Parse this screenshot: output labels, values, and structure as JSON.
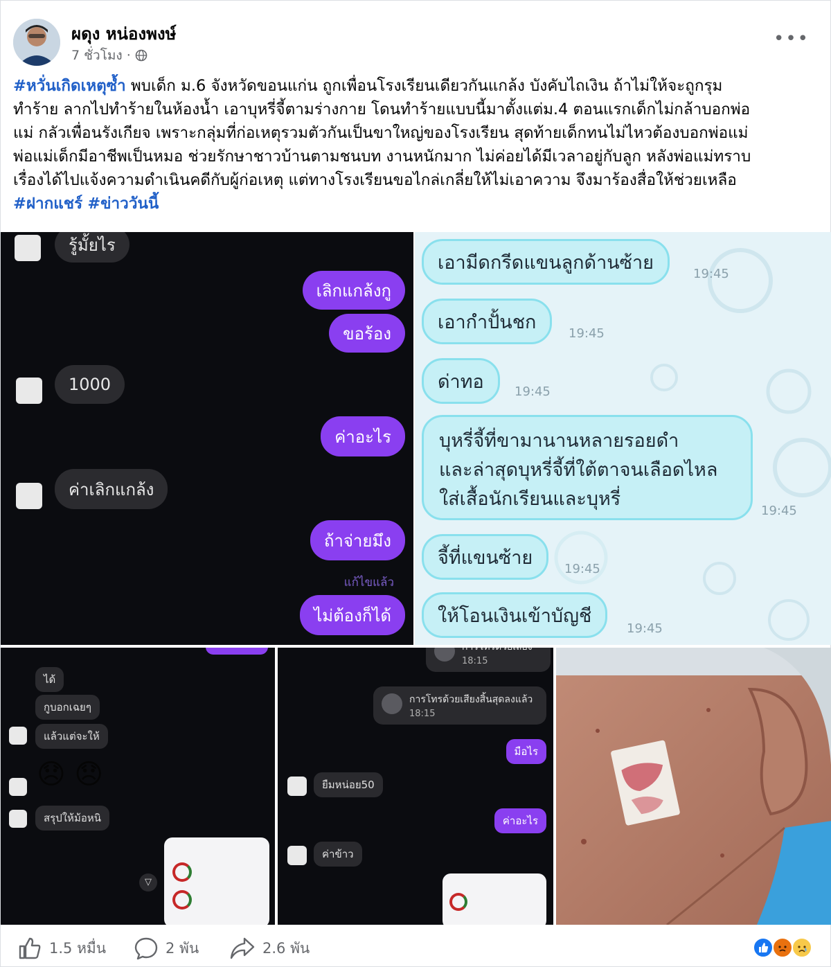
{
  "post": {
    "author": "ผดุง หน่องพงษ์",
    "time": "7 ชั่วโมง",
    "separator": "·",
    "more": "•••",
    "text_lines": [
      {
        "hashtag": "#หวั่นเกิดเหตุซ้ำ",
        "text": " พบเด็ก ม.6 จังหวัดขอนแก่น ถูกเพื่อนโรงเรียนเดียวกันแกล้ง บังคับไถเงิน ถ้าไม่ให้จะถูกรุม"
      },
      {
        "text": "ทำร้าย ลากไปทำร้ายในห้องน้ำ เอาบุหรี่จี้ตามร่างกาย โดนทำร้ายแบบนี้มาตั้งแต่ม.4 ตอนแรกเด็กไม่กล้าบอกพ่อ"
      },
      {
        "text": "แม่ กลัวเพื่อนรังเกียจ เพราะกลุ่มที่ก่อเหตุรวมตัวกันเป็นขาใหญ่ของโรงเรียน สุดท้ายเด็กทนไม่ไหวต้องบอกพ่อแม่"
      },
      {
        "text": "พ่อแม่เด็กมีอาชีพเป็นหมอ ช่วยรักษาชาวบ้านตามชนบท งานหนักมาก ไม่ค่อยได้มีเวลาอยู่กับลูก หลังพ่อแม่ทราบ"
      },
      {
        "text": "เรื่องได้ไปแจ้งความดำเนินคดีกับผู้ก่อเหตุ แต่ทางโรงเรียนขอไกล่เกลี่ยให้ไม่เอาความ จึงมาร้องสื่อให้ช่วยเหลือ"
      }
    ],
    "hashtags_line": [
      "#ฝากแชร์",
      "#ข่าววันนี้"
    ]
  },
  "chat1": {
    "messages": [
      {
        "side": "left",
        "text": "รู้มั้ยไร"
      },
      {
        "side": "right",
        "text": "เลิกแกล้งกู"
      },
      {
        "side": "right",
        "text": "ขอร้อง"
      },
      {
        "side": "left",
        "text": "1000"
      },
      {
        "side": "right",
        "text": "ค่าอะไร"
      },
      {
        "side": "left",
        "text": "ค่าเลิกแกล้ง"
      },
      {
        "side": "right",
        "text": "ถ้าจ่ายมึง"
      },
      {
        "side": "note",
        "text": "แก้ไขแล้ว"
      },
      {
        "side": "right",
        "text": "ไม่ต้องก็ได้"
      }
    ]
  },
  "chat2": {
    "messages": [
      {
        "text": "เอามีดกรีดแขนลูกด้านซ้าย",
        "time": "19:45"
      },
      {
        "text": "เอากำปั้นชก",
        "time": "19:45"
      },
      {
        "text": "ด่าทอ",
        "time": "19:45"
      },
      {
        "lines": [
          "บุหรี่จี้ที่ขามานานหลายรอยดำ",
          "และล่าสุดบุหรี่จี้ที่ใต้ตาจนเลือดไหล",
          "ใส่เสื้อนักเรียนและบุหรี่"
        ],
        "time": "19:45"
      },
      {
        "text": "จี้ที่แขนซ้าย",
        "time": "19:45"
      },
      {
        "text": "ให้โอนเงินเข้าบัญชี",
        "time": "19:45"
      }
    ]
  },
  "chat3": {
    "messages": [
      "ได้",
      "กูบอกเฉยๆ",
      "แล้วแต่จะให้",
      "สรุปให้ม้อหนิ"
    ],
    "emoji": "😞 😞"
  },
  "chat4": {
    "calls": [
      {
        "title": "การโทรด้วยเสียง",
        "time": "18:15"
      },
      {
        "title": "การโทรด้วยเสียงสิ้นสุดลงแล้ว",
        "time": "18:15"
      }
    ],
    "messages": [
      {
        "side": "right",
        "text": "มือไร"
      },
      {
        "side": "left",
        "text": "ยืมหน่อย50"
      },
      {
        "side": "right",
        "text": "ค่าอะไร"
      },
      {
        "side": "left",
        "text": "ค่าข้าว"
      }
    ]
  },
  "footer": {
    "likes": "1.5 หมื่น",
    "comments": "2 พัน",
    "shares": "2.6 พัน"
  },
  "colors": {
    "hashtag": "#2160c8",
    "purple_bubble": "#8a3ff0",
    "cyan_bubble": "#c6f0f6",
    "dark_bg": "#0b0c10"
  }
}
